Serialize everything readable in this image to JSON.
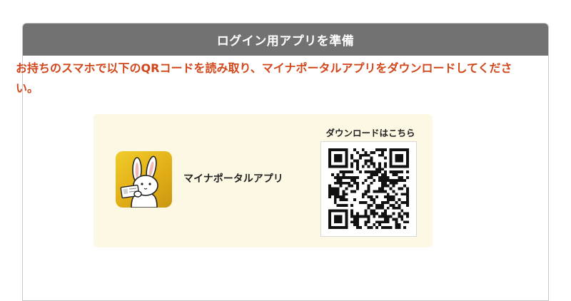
{
  "panel": {
    "title": "ログイン用アプリを準備",
    "instruction": "お持ちのスマホで以下のQRコードを読み取り、マイナポータルアプリをダウンロードしてください。"
  },
  "card": {
    "app_name": "マイナポータルアプリ",
    "app_icon": "rabbit-mascot-icon",
    "qr_caption": "ダウンロードはこちら"
  },
  "colors": {
    "header_bg": "#727272",
    "instruction_text": "#d1461a",
    "card_bg": "#fdf8e3",
    "icon_bg": "#e6b21c"
  }
}
